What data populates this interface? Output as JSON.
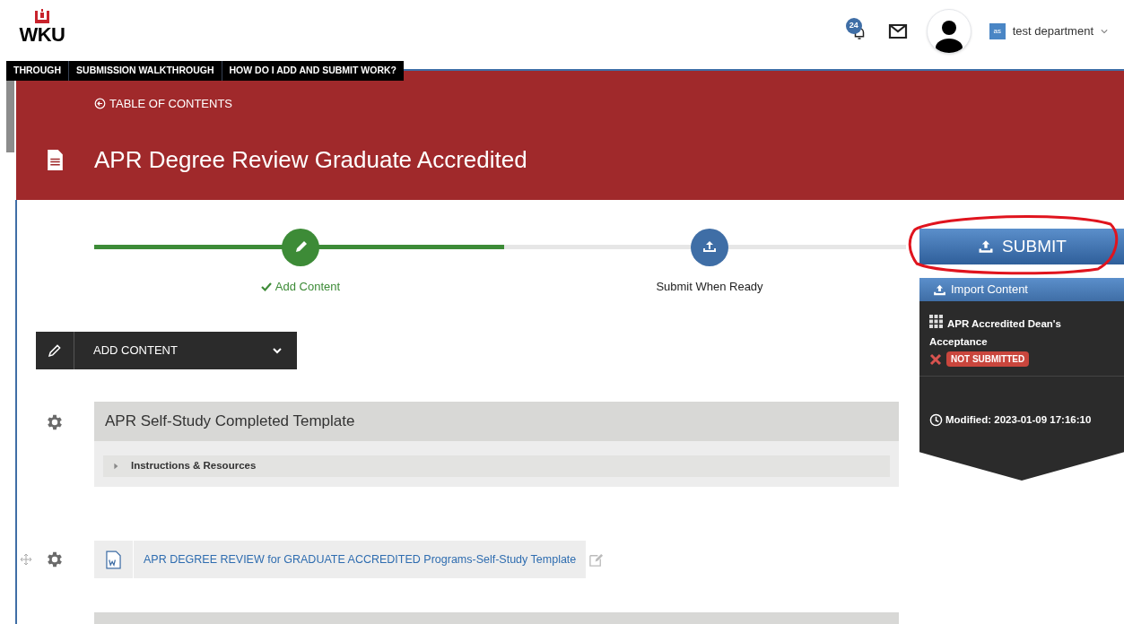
{
  "header": {
    "logo": "WKU",
    "notification_count": "24",
    "user_initials": "as",
    "user_name": "test department"
  },
  "nav_tabs": [
    "THROUGH",
    "SUBMISSION WALKTHROUGH",
    "HOW DO I ADD AND SUBMIT WORK?"
  ],
  "banner": {
    "back_link": "TABLE OF CONTENTS",
    "title": "APR Degree Review Graduate Accredited"
  },
  "steps": [
    {
      "label": "Add Content",
      "completed": true
    },
    {
      "label": "Submit When Ready",
      "completed": false
    }
  ],
  "side_panel": {
    "submit_button": "SUBMIT",
    "import_button": "Import Content",
    "requirement": {
      "title": "APR Accredited Dean's Acceptance",
      "status": "NOT SUBMITTED"
    },
    "modified": "Modified: 2023-01-09 17:16:10"
  },
  "add_content": "ADD CONTENT",
  "items": [
    {
      "kind": "section",
      "title": "APR Self-Study Completed Template",
      "children": [
        {
          "label": "Instructions & Resources",
          "expanded": false
        }
      ]
    },
    {
      "kind": "document",
      "title": "APR DEGREE REVIEW for GRADUATE ACCREDITED Programs-Self-Study Template"
    }
  ]
}
